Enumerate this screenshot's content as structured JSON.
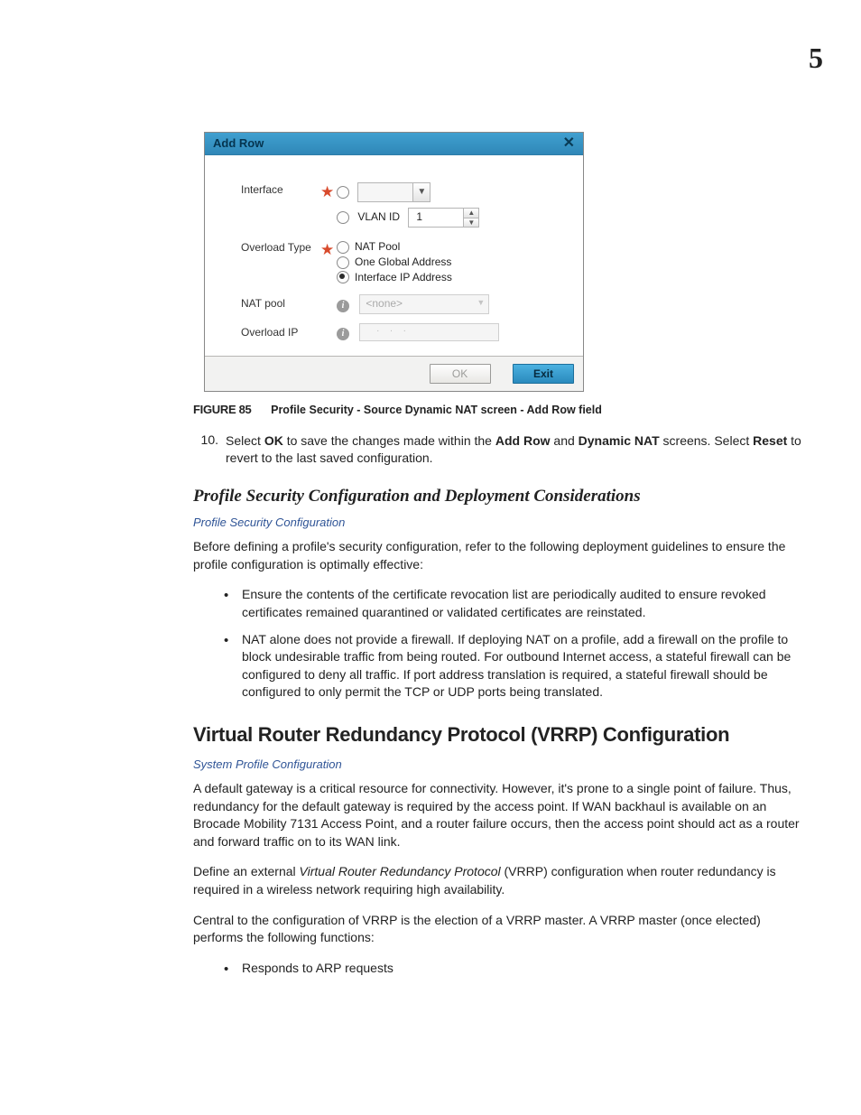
{
  "page_number": "5",
  "dialog": {
    "title": "Add Row",
    "close_glyph": "✕",
    "rows": {
      "interface": {
        "label": "Interface",
        "dropdown_value": "",
        "vlan_label": "VLAN ID",
        "vlan_value": "1"
      },
      "overload_type": {
        "label": "Overload Type",
        "opt_nat_pool": "NAT Pool",
        "opt_global": "One Global Address",
        "opt_ifip": "Interface IP Address"
      },
      "nat_pool": {
        "label": "NAT pool",
        "value": "<none>"
      },
      "overload_ip": {
        "label": "Overload IP",
        "value": "..."
      }
    },
    "buttons": {
      "ok": "OK",
      "exit": "Exit"
    },
    "info_glyph": "i"
  },
  "figure": {
    "label": "FIGURE 85",
    "title": "Profile Security - Source Dynamic NAT screen - Add Row field"
  },
  "step10": {
    "num": "10.",
    "pre": "Select ",
    "ok": "OK",
    "mid1": " to save the changes made within the ",
    "addrow": "Add Row",
    "mid2": " and ",
    "dynnat": "Dynamic NAT",
    "mid3": " screens. Select ",
    "reset": "Reset",
    "post": " to revert to the last saved configuration."
  },
  "sectionA": {
    "heading": "Profile Security Configuration and Deployment Considerations",
    "link": "Profile Security Configuration",
    "intro": "Before defining a profile's security configuration, refer to the following deployment guidelines to ensure the profile configuration is optimally effective:",
    "b1": "Ensure the contents of the certificate revocation list are periodically audited to ensure revoked certificates remained quarantined or validated certificates are reinstated.",
    "b2": "NAT alone does not provide a firewall. If deploying NAT on a profile, add a firewall on the profile to block undesirable traffic from being routed. For outbound Internet access, a stateful firewall can be configured to deny all traffic. If port address translation is required, a stateful firewall should be configured to only permit the TCP or UDP ports being translated."
  },
  "sectionB": {
    "heading": "Virtual Router Redundancy Protocol (VRRP) Configuration",
    "link": "System Profile Configuration",
    "p1": "A default gateway is a critical resource for connectivity. However, it's prone to a single point of failure. Thus, redundancy for the default gateway is required by the access point. If WAN backhaul is available on an Brocade Mobility 7131 Access Point, and a router failure occurs, then the access point should act as a router and forward traffic on to its WAN link.",
    "p2_pre": "Define an external ",
    "p2_em": "Virtual Router Redundancy Protocol",
    "p2_post": " (VRRP) configuration when router redundancy is required in a wireless network requiring high availability.",
    "p3": "Central to the configuration of VRRP is the election of a VRRP master. A VRRP master (once elected) performs the following functions:",
    "b1": "Responds to ARP requests"
  }
}
